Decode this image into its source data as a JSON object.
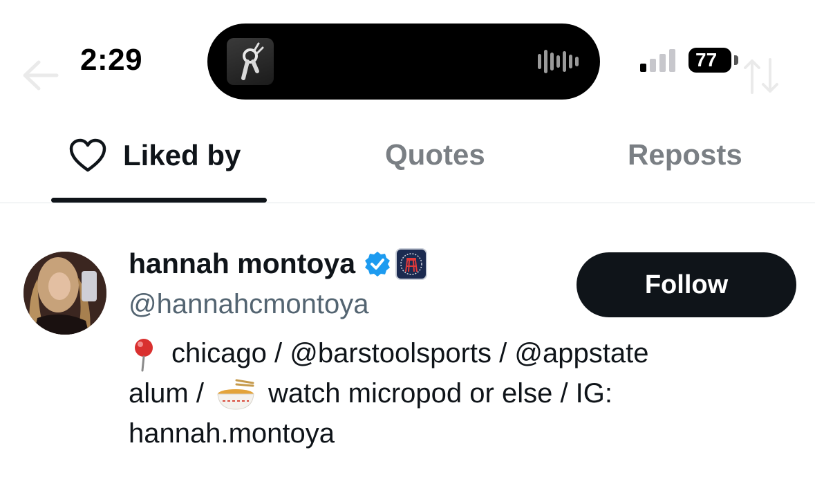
{
  "status_bar": {
    "time": "2:29",
    "battery": "77"
  },
  "tabs": [
    {
      "label": "Liked by",
      "active": true
    },
    {
      "label": "Quotes",
      "active": false
    },
    {
      "label": "Reposts",
      "active": false
    }
  ],
  "user": {
    "name": "hannah montoya",
    "handle": "@hannahcmontoya",
    "verified": true,
    "follow_label": "Follow",
    "bio_lines": {
      "line1": "chicago / @barstoolsports / @appstate",
      "line2_prefix": "alum / ",
      "line2_suffix": "watch micropod or else / IG:",
      "line3": "hannah.montoya"
    }
  },
  "colors": {
    "text_primary": "#0f1419",
    "text_secondary": "#536471",
    "tab_inactive": "#7a7f84",
    "verified_blue": "#1d9bf0",
    "follow_bg": "#0f1419"
  },
  "icons": [
    "back-arrow-icon",
    "heart-icon",
    "verified-badge-icon",
    "barstool-affiliate-icon",
    "pushpin-emoji-icon",
    "noodle-bowl-emoji-icon",
    "signal-icon",
    "battery-icon",
    "sort-icon"
  ]
}
